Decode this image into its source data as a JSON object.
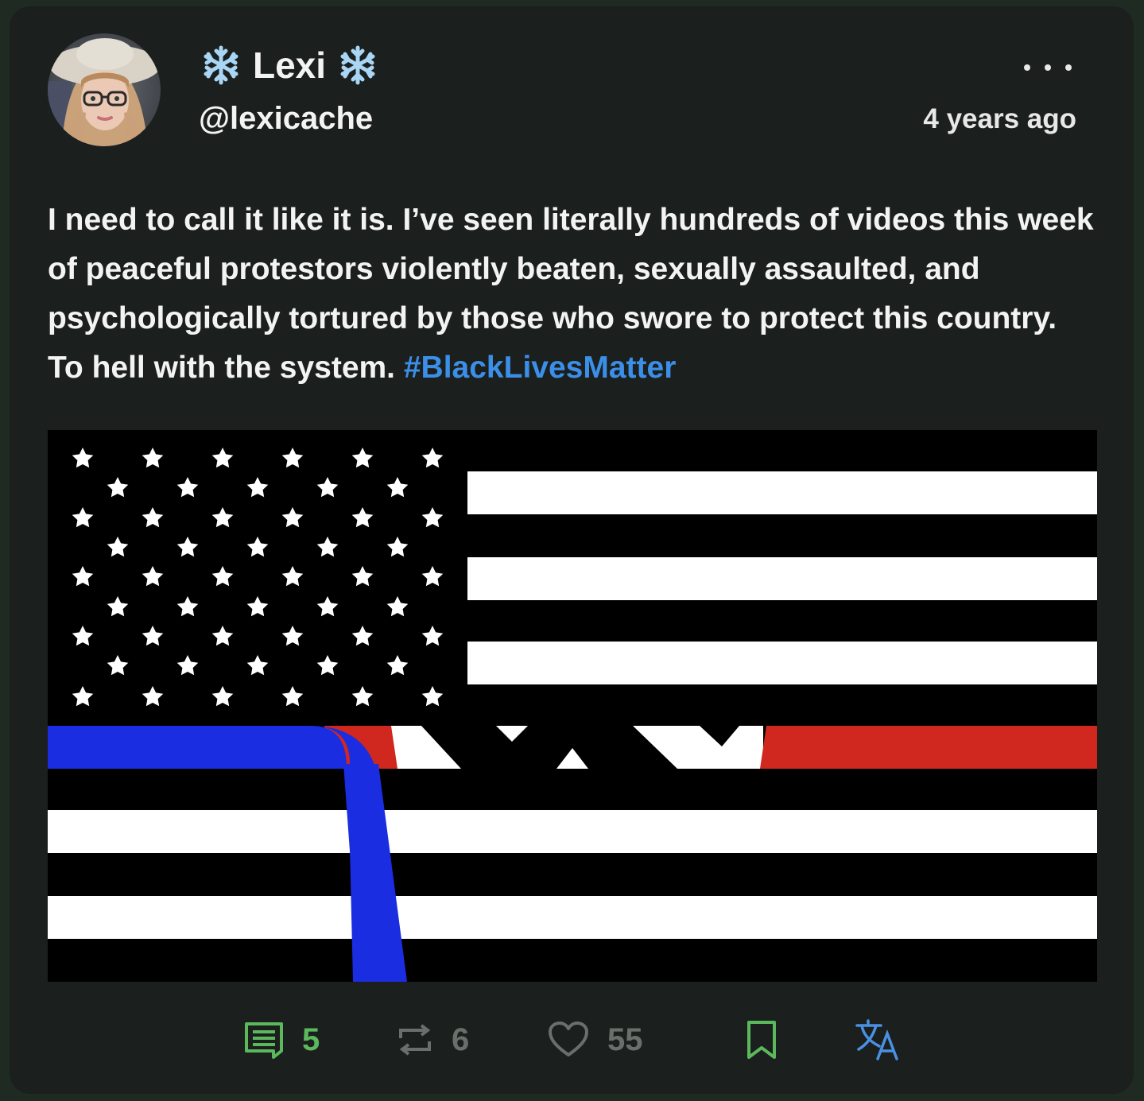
{
  "post": {
    "display_name": "Lexi",
    "name_decoration_icon": "snowflake-icon",
    "handle": "@lexicache",
    "time": "4 years ago",
    "text": "I need to call it like it is. I’ve seen literally hundreds of videos this week of peaceful protestors violently beaten, sexually assaulted, and psychologically tortured by those who swore to protect this country. To hell with the system. ",
    "hashtag": "#BlackLivesMatter"
  },
  "actions": {
    "replies": {
      "icon": "comment-icon",
      "count": "5"
    },
    "reposts": {
      "icon": "repost-icon",
      "count": "6"
    },
    "likes": {
      "icon": "heart-icon",
      "count": "55"
    },
    "bookmark": {
      "icon": "bookmark-icon"
    },
    "translate": {
      "icon": "translate-icon"
    }
  },
  "colors": {
    "background": "#1e2a22",
    "card": "#1b1f1d",
    "text": "#f3f3f3",
    "hashtag": "#3b8fe8",
    "reply_green": "#5cb85c",
    "muted_gray": "#6b6f6c",
    "translate_blue": "#4a90e2",
    "flag_blue": "#1a2de0",
    "flag_red": "#d0281f"
  }
}
